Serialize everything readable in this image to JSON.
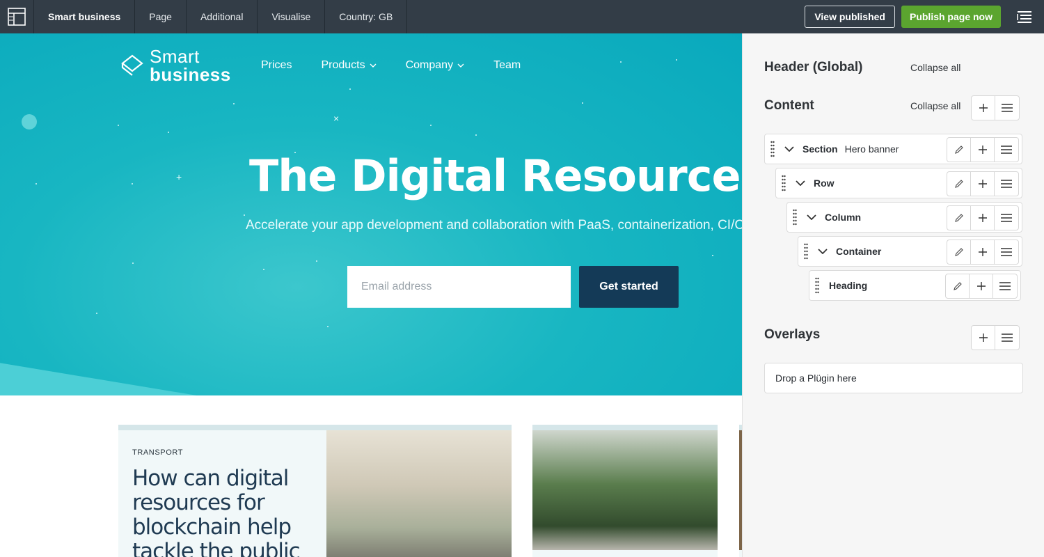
{
  "toolbar": {
    "brand": "Smart business",
    "tabs": [
      "Page",
      "Additional",
      "Visualise",
      "Country: GB"
    ],
    "view_published": "View published",
    "publish": "Publish page now"
  },
  "site": {
    "logo_line1": "Smart",
    "logo_line2": "business",
    "nav": [
      {
        "label": "Prices",
        "dropdown": false
      },
      {
        "label": "Products",
        "dropdown": true
      },
      {
        "label": "Company",
        "dropdown": true
      },
      {
        "label": "Team",
        "dropdown": false
      }
    ],
    "hero_title": "The Digital Resource Marketpla",
    "hero_subtitle": "Accelerate your app development and collaboration with PaaS, containerization, CI/CD,",
    "email_placeholder": "Email address",
    "cta": "Get started"
  },
  "cards": {
    "card1_category": "TRANSPORT",
    "card1_title": "How can digital resources for blockchain help tackle the public"
  },
  "panel": {
    "header_title": "Header (Global)",
    "content_title": "Content",
    "overlays_title": "Overlays",
    "collapse_all": "Collapse all",
    "tree": [
      {
        "name": "Section",
        "sub": "Hero banner",
        "level": 0,
        "expandable": true
      },
      {
        "name": "Row",
        "sub": "",
        "level": 1,
        "expandable": true
      },
      {
        "name": "Column",
        "sub": "",
        "level": 2,
        "expandable": true
      },
      {
        "name": "Container",
        "sub": "",
        "level": 3,
        "expandable": true
      },
      {
        "name": "Heading",
        "sub": "",
        "level": 4,
        "expandable": false
      }
    ],
    "dropzone": "Drop a Plügin here"
  },
  "colors": {
    "toolbar_bg": "#333d47",
    "publish_green": "#5ba52f",
    "hero_teal": "#18b6c2",
    "cta_navy": "#143a57"
  }
}
